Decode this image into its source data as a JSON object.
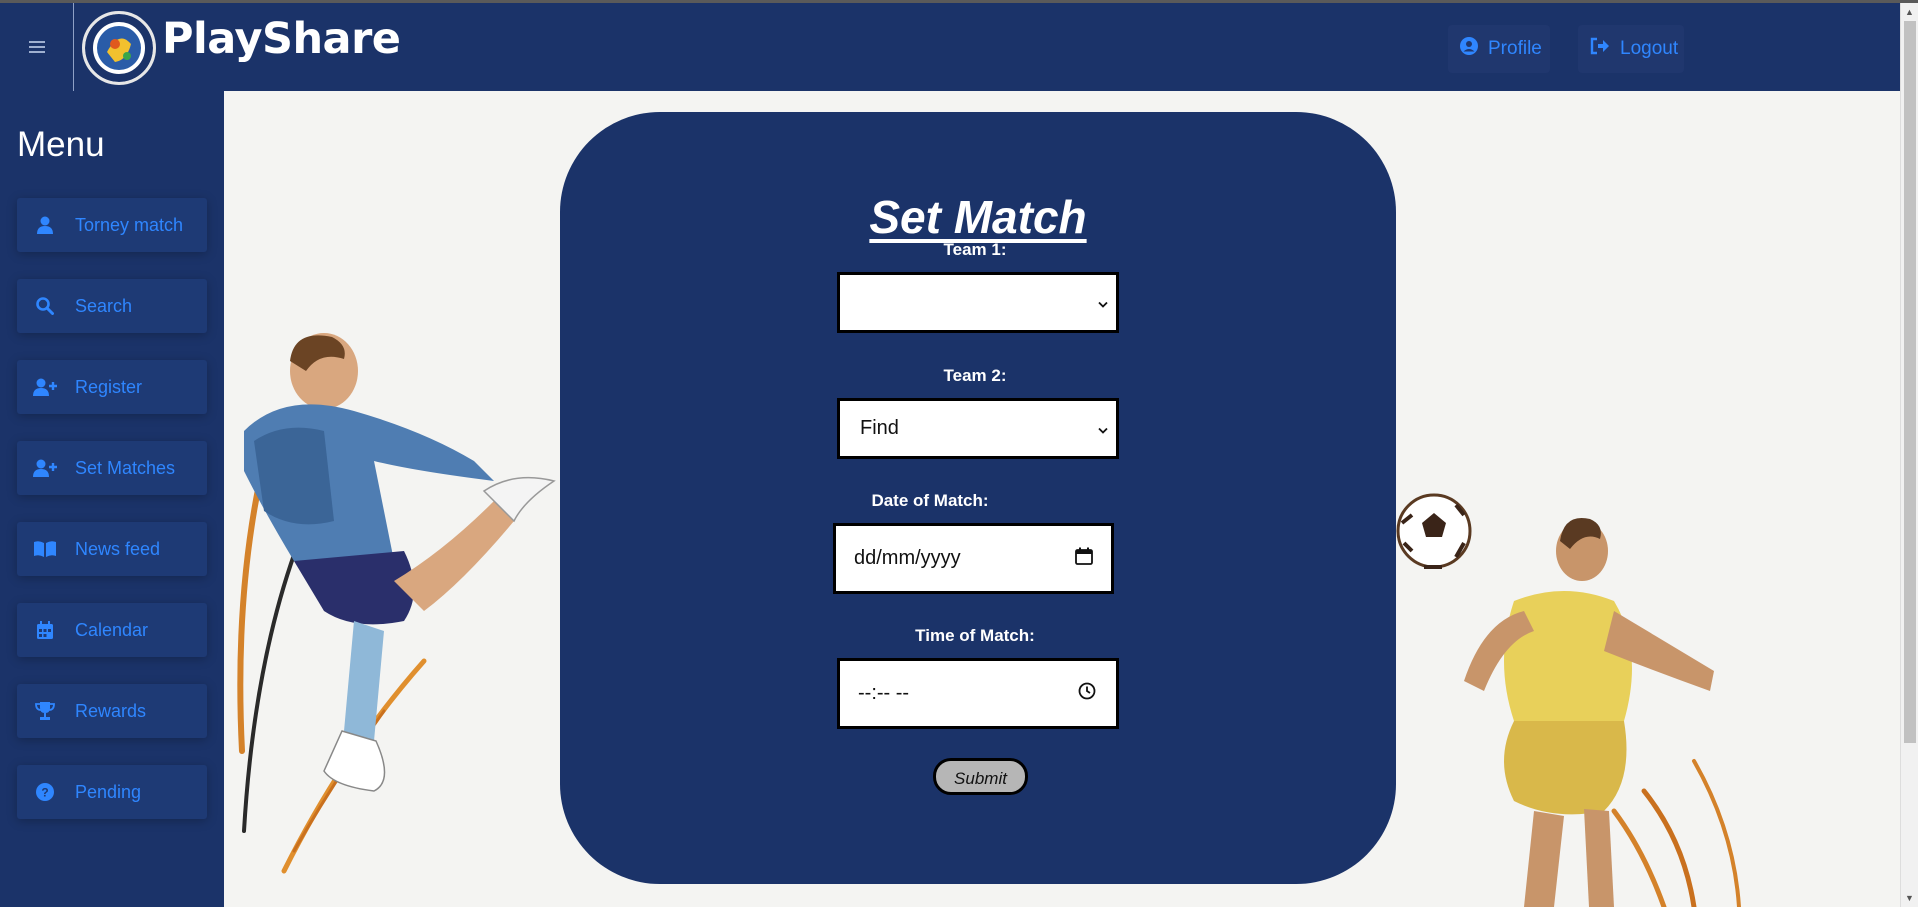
{
  "header": {
    "brand": "PlayShare",
    "profile_label": "Profile",
    "logout_label": "Logout"
  },
  "sidebar": {
    "title": "Menu",
    "items": [
      {
        "label": "Torney match",
        "icon": "user-icon"
      },
      {
        "label": "Search",
        "icon": "search-icon"
      },
      {
        "label": "Register",
        "icon": "user-plus-icon"
      },
      {
        "label": "Set Matches",
        "icon": "user-plus-icon"
      },
      {
        "label": "News feed",
        "icon": "book-open-icon"
      },
      {
        "label": "Calendar",
        "icon": "calendar-icon"
      },
      {
        "label": "Rewards",
        "icon": "trophy-icon"
      },
      {
        "label": "Pending",
        "icon": "question-circle-icon"
      }
    ]
  },
  "form": {
    "title": "Set Match",
    "team1_label": "Team 1:",
    "team1_value": "",
    "team2_label": "Team 2:",
    "team2_value": "Find",
    "date_label": "Date of Match:",
    "date_placeholder": "dd/mm/yyyy",
    "time_label": "Time of Match:",
    "time_placeholder": "--:-- --",
    "submit_label": "Submit"
  },
  "colors": {
    "navy": "#1b3369",
    "link_blue": "#2f86ff",
    "background": "#f4f4f2"
  }
}
